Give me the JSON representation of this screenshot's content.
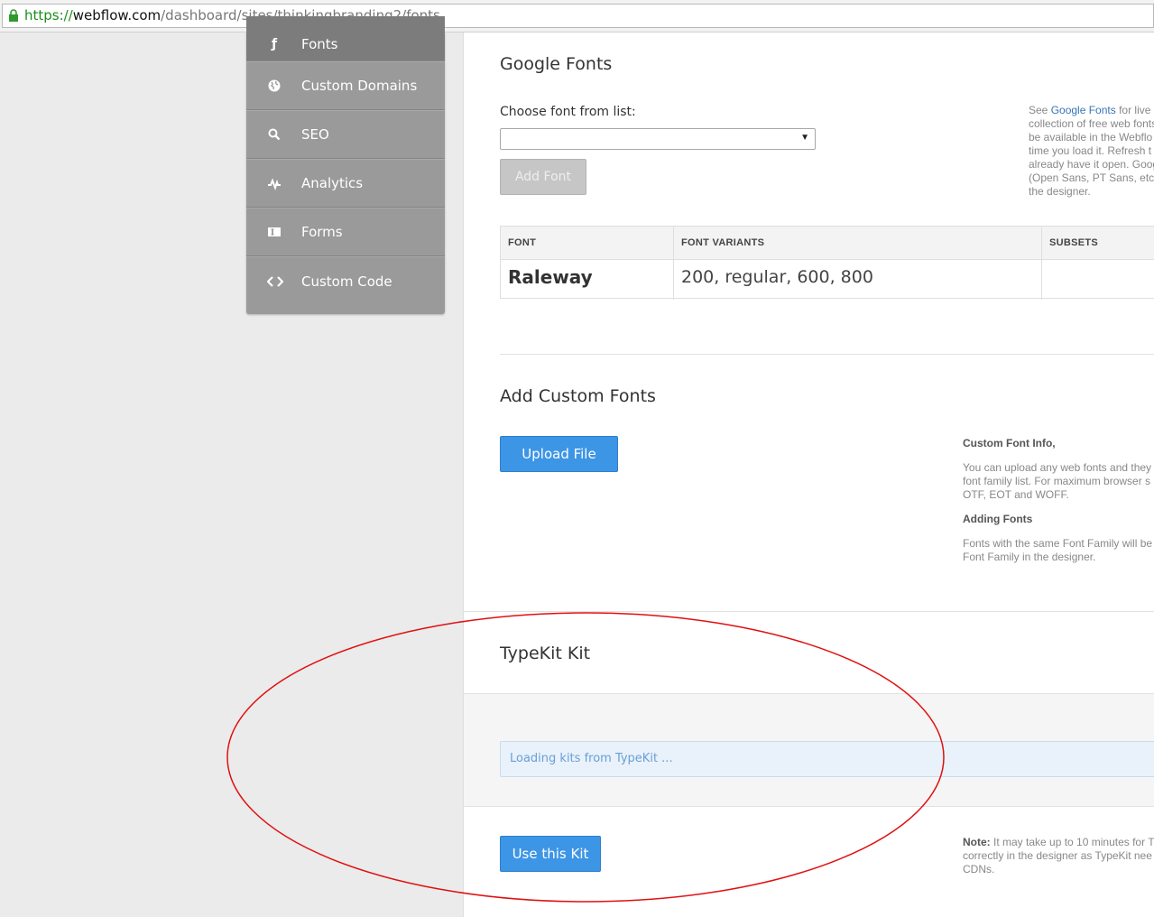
{
  "browser": {
    "url_scheme": "https://",
    "url_domain": "webflow.com",
    "url_path": "/dashboard/sites/thinkingbranding2/fonts"
  },
  "sidebar": {
    "items": [
      {
        "label": "Fonts",
        "icon": "font-icon",
        "active": true
      },
      {
        "label": "Custom Domains",
        "icon": "globe-icon"
      },
      {
        "label": "SEO",
        "icon": "search-icon"
      },
      {
        "label": "Analytics",
        "icon": "pulse-icon"
      },
      {
        "label": "Forms",
        "icon": "form-icon"
      },
      {
        "label": "Custom Code",
        "icon": "code-icon"
      }
    ]
  },
  "google_fonts": {
    "title": "Google Fonts",
    "choose_label": "Choose font from list:",
    "select_value": "",
    "add_button": "Add Font",
    "info": {
      "line1_prefix": "See ",
      "line1_link": "Google Fonts",
      "line1_suffix": " for live",
      "line2": "collection of free web fonts",
      "line3": "be available in the Webflo",
      "line4": "time you load it. Refresh t",
      "line5": "already have it open. Goog",
      "line6": "(Open Sans, PT Sans, etc",
      "line7": "the designer."
    },
    "table": {
      "headers": [
        "FONT",
        "FONT VARIANTS",
        "SUBSETS"
      ],
      "rows": [
        {
          "font": "Raleway",
          "variants": "200, regular, 600, 800",
          "subsets": ""
        }
      ]
    }
  },
  "custom_fonts": {
    "title": "Add Custom Fonts",
    "upload_button": "Upload File",
    "info_title": "Custom Font Info,",
    "info_line1": "You can upload any web fonts and they",
    "info_line2": "font family list. For maximum browser s",
    "info_line3": "OTF, EOT and WOFF.",
    "adding_title": "Adding Fonts",
    "adding_line1": "Fonts with the same Font Family will be",
    "adding_line2": "Font Family in the designer."
  },
  "typekit": {
    "title": "TypeKit Kit",
    "loading_text": "Loading kits from TypeKit ...",
    "use_button": "Use this Kit",
    "note_label": "Note:",
    "note_line1": " It may take up to 10 minutes for T",
    "note_line2": "correctly in the designer as TypeKit nee",
    "note_line3": "CDNs."
  },
  "colors": {
    "accent": "#3d95e6",
    "annotation": "#e01010"
  }
}
